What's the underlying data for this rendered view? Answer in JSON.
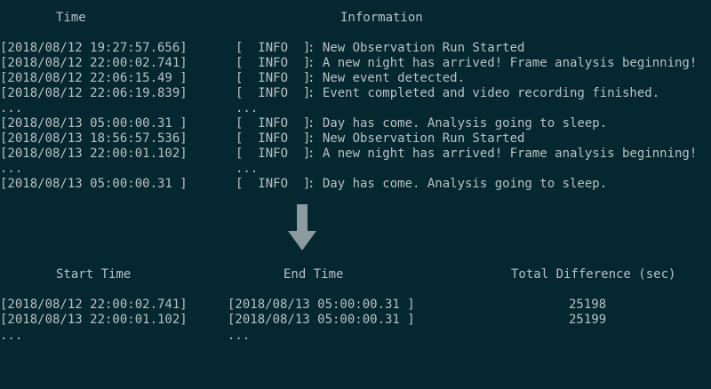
{
  "log_table": {
    "headers": {
      "time": "Time",
      "information": "Information"
    },
    "rows": [
      {
        "time": "[2018/08/12 19:27:57.656]",
        "level": "[  INFO  ]",
        "message": ": New Observation Run Started"
      },
      {
        "time": "[2018/08/12 22:00:02.741]",
        "level": "[  INFO  ]",
        "message": ": A new night has arrived! Frame analysis beginning!"
      },
      {
        "time": "[2018/08/12 22:06:15.49 ]",
        "level": "[  INFO  ]",
        "message": ": New event detected."
      },
      {
        "time": "[2018/08/12 22:06:19.839]",
        "level": "[  INFO  ]",
        "message": ": Event completed and video recording finished."
      },
      {
        "time": "...",
        "level": "...",
        "message": ""
      },
      {
        "time": "[2018/08/13 05:00:00.31 ]",
        "level": "[  INFO  ]",
        "message": ": Day has come. Analysis going to sleep."
      },
      {
        "time": "[2018/08/13 18:56:57.536]",
        "level": "[  INFO  ]",
        "message": ": New Observation Run Started"
      },
      {
        "time": "[2018/08/13 22:00:01.102]",
        "level": "[  INFO  ]",
        "message": ": A new night has arrived! Frame analysis beginning!"
      },
      {
        "time": "...",
        "level": "...",
        "message": ""
      },
      {
        "time": "[2018/08/13 05:00:00.31 ]",
        "level": "[  INFO  ]",
        "message": ": Day has come. Analysis going to sleep."
      }
    ]
  },
  "arrow": {
    "icon": "arrow-down-icon",
    "color": "#8c9ba0"
  },
  "summary_table": {
    "headers": {
      "start": "Start Time",
      "end": "End Time",
      "diff": "Total Difference (sec)"
    },
    "rows": [
      {
        "start": "[2018/08/12 22:00:02.741]",
        "end": "[2018/08/13 05:00:00.31 ]",
        "diff": "25198"
      },
      {
        "start": "[2018/08/13 22:00:01.102]",
        "end": "[2018/08/13 05:00:00.31 ]",
        "diff": "25199"
      },
      {
        "start": "...",
        "end": "...",
        "diff": ""
      }
    ]
  },
  "colors": {
    "background": "#05272f",
    "text": "#b8c2c4"
  }
}
